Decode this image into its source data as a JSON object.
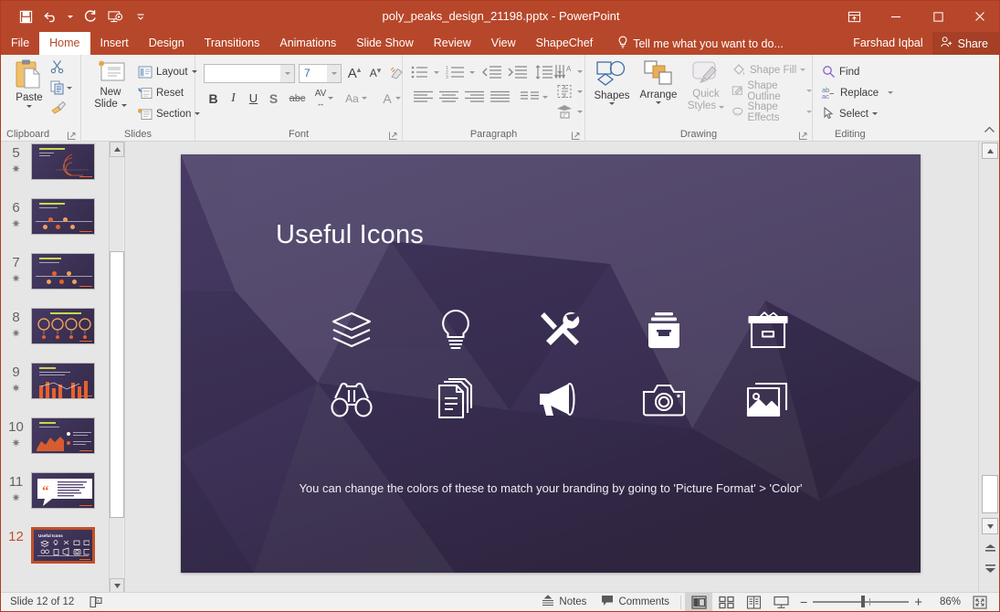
{
  "window": {
    "title": "poly_peaks_design_21198.pptx - PowerPoint",
    "qat": [
      {
        "name": "save",
        "label": "Save"
      },
      {
        "name": "undo",
        "label": "Undo"
      },
      {
        "name": "redo",
        "label": "Redo"
      },
      {
        "name": "start-presentation",
        "label": "Start From Beginning"
      },
      {
        "name": "customize-qat",
        "label": "Customize Quick Access Toolbar"
      }
    ],
    "controls": [
      {
        "name": "ribbon-display-options",
        "label": "Ribbon Display Options"
      },
      {
        "name": "minimize",
        "label": "Minimize"
      },
      {
        "name": "restore",
        "label": "Restore Down"
      },
      {
        "name": "close",
        "label": "Close"
      }
    ]
  },
  "tabs": [
    {
      "label": "File",
      "active": false
    },
    {
      "label": "Home",
      "active": true
    },
    {
      "label": "Insert",
      "active": false
    },
    {
      "label": "Design",
      "active": false
    },
    {
      "label": "Transitions",
      "active": false
    },
    {
      "label": "Animations",
      "active": false
    },
    {
      "label": "Slide Show",
      "active": false
    },
    {
      "label": "Review",
      "active": false
    },
    {
      "label": "View",
      "active": false
    },
    {
      "label": "ShapeChef",
      "active": false
    }
  ],
  "tellme": {
    "label": "Tell me what you want to do..."
  },
  "account": {
    "user": "Farshad Iqbal",
    "share_label": "Share"
  },
  "ribbon": {
    "groups": [
      {
        "name": "clipboard",
        "label": "Clipboard"
      },
      {
        "name": "slides",
        "label": "Slides"
      },
      {
        "name": "font",
        "label": "Font"
      },
      {
        "name": "paragraph",
        "label": "Paragraph"
      },
      {
        "name": "drawing",
        "label": "Drawing"
      },
      {
        "name": "editing",
        "label": "Editing"
      }
    ],
    "clipboard": {
      "paste_label": "Paste",
      "cut_label": "Cut",
      "copy_label": "Copy",
      "format_painter_label": "Format Painter"
    },
    "slides": {
      "new_slide_line1": "New",
      "new_slide_line2": "Slide",
      "layout_label": "Layout",
      "reset_label": "Reset",
      "section_label": "Section"
    },
    "font": {
      "font_name": "",
      "font_name_placeholder": "",
      "font_size": "7",
      "grow_font_label": "A",
      "shrink_font_label": "A",
      "clear_formatting_label": "Clear All Formatting",
      "bold_label": "B",
      "italic_label": "I",
      "underline_label": "U",
      "shadow_label": "S",
      "strikethrough_label": "abc",
      "char_spacing_label": "AV",
      "change_case_label": "Aa",
      "font_color_label": "A"
    },
    "drawing": {
      "shapes_label": "Shapes",
      "arrange_label": "Arrange",
      "quick_styles_line1": "Quick",
      "quick_styles_line2": "Styles",
      "shape_fill_label": "Shape Fill",
      "shape_outline_label": "Shape Outline",
      "shape_effects_label": "Shape Effects"
    },
    "editing": {
      "find_label": "Find",
      "replace_label": "Replace",
      "select_label": "Select",
      "collapse_label": "Collapse the Ribbon"
    }
  },
  "thumbnails": [
    {
      "number": "5",
      "starred": true,
      "selected": false,
      "kind": "radar"
    },
    {
      "number": "6",
      "starred": true,
      "selected": false,
      "kind": "timeline"
    },
    {
      "number": "7",
      "starred": true,
      "selected": false,
      "kind": "timeline"
    },
    {
      "number": "8",
      "starred": true,
      "selected": false,
      "kind": "gauges"
    },
    {
      "number": "9",
      "starred": true,
      "selected": false,
      "kind": "bars"
    },
    {
      "number": "10",
      "starred": true,
      "selected": false,
      "kind": "area"
    },
    {
      "number": "11",
      "starred": true,
      "selected": false,
      "kind": "quote"
    },
    {
      "number": "12",
      "starred": false,
      "selected": true,
      "kind": "icons"
    }
  ],
  "slide": {
    "title": "Useful Icons",
    "caption": "You can change the colors of these to match your branding by going to 'Picture Format' > 'Color'",
    "icons_row1": [
      "layers-icon",
      "lightbulb-icon",
      "tools-icon",
      "file-box-icon",
      "archive-box-icon"
    ],
    "icons_row2": [
      "binoculars-icon",
      "documents-icon",
      "megaphone-icon",
      "camera-icon",
      "photo-icon"
    ],
    "background_color": "#3e3257",
    "accent_color": "#e8612c"
  },
  "statusbar": {
    "slide_counter": "Slide 12 of 12",
    "language_icon": "spelling-icon",
    "notes_label": "Notes",
    "comments_label": "Comments",
    "views": [
      {
        "name": "normal-view",
        "active": true
      },
      {
        "name": "slide-sorter-view",
        "active": false
      },
      {
        "name": "reading-view",
        "active": false
      },
      {
        "name": "slide-show-view",
        "active": false
      }
    ],
    "zoom_out_label": "−",
    "zoom_in_label": "+",
    "zoom_level": "86%",
    "fit_label": "Fit slide to current window"
  },
  "scroll": {
    "up_label": "Scroll Up",
    "down_label": "Scroll Down",
    "prev_slide_label": "Previous Slide",
    "next_slide_label": "Next Slide"
  }
}
